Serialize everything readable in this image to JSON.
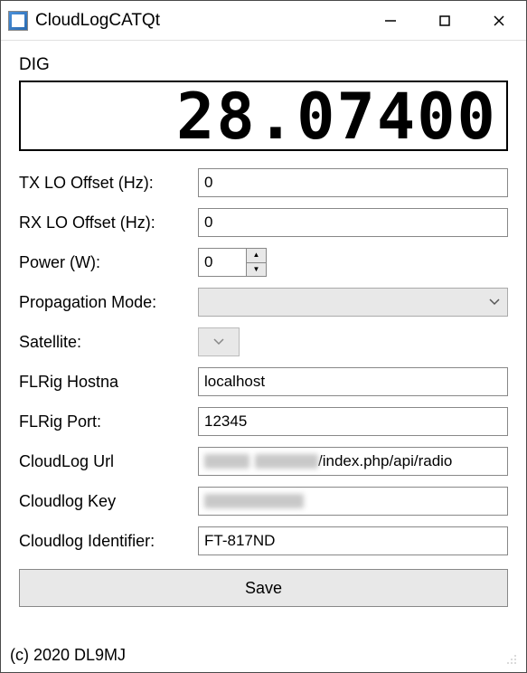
{
  "window": {
    "title": "CloudLogCATQt"
  },
  "mode": "DIG",
  "frequency": "28.07400",
  "fields": {
    "tx_lo_offset": {
      "label": "TX LO Offset (Hz):",
      "value": "0"
    },
    "rx_lo_offset": {
      "label": "RX LO Offset (Hz):",
      "value": "0"
    },
    "power": {
      "label": "Power (W):",
      "value": "0"
    },
    "propagation_mode": {
      "label": "Propagation Mode:",
      "value": ""
    },
    "satellite": {
      "label": "Satellite:",
      "value": ""
    },
    "flrig_hostname": {
      "label": "FLRig Hostna",
      "value": "localhost"
    },
    "flrig_port": {
      "label": "FLRig Port:",
      "value": "12345"
    },
    "cloudlog_url": {
      "label": "CloudLog Url",
      "value_suffix": "/index.php/api/radio"
    },
    "cloudlog_key": {
      "label": "Cloudlog Key",
      "value": ""
    },
    "cloudlog_identifier": {
      "label": "Cloudlog Identifier:",
      "value": "FT-817ND"
    }
  },
  "buttons": {
    "save": "Save"
  },
  "footer": {
    "copyright": "(c) 2020 DL9MJ"
  }
}
